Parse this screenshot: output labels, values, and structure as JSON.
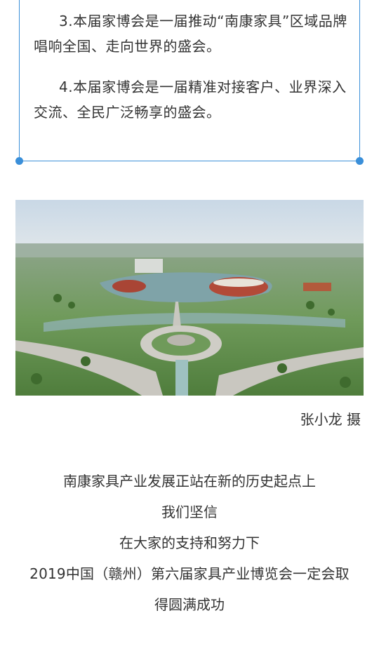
{
  "quote_box": {
    "paragraph_3": "3.本届家博会是一届推动“南康家具”区域品牌唱响全国、走向世界的盛会。",
    "paragraph_4": "4.本届家博会是一届精准对接客户、业界深入交流、全民广泛畅享的盛会。",
    "accent_color": "#3a8fd9"
  },
  "photo": {
    "caption": "张小龙 摄"
  },
  "closing": {
    "line_1": "南康家具产业发展正站在新的历史起点上",
    "line_2": "我们坚信",
    "line_3": "在大家的支持和努力下",
    "line_4": "2019中国（赣州）第六届家具产业博览会一定会取",
    "line_5": "得圆满成功"
  }
}
